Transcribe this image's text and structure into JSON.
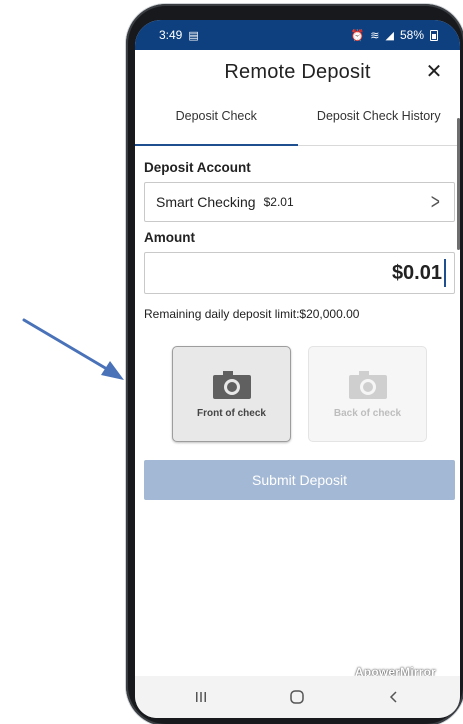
{
  "status_bar": {
    "time": "3:49",
    "battery": "58%"
  },
  "header": {
    "title": "Remote Deposit",
    "close_glyph": "✕"
  },
  "tabs": [
    {
      "label": "Deposit Check",
      "active": true
    },
    {
      "label": "Deposit Check History",
      "active": false
    }
  ],
  "deposit_account": {
    "label": "Deposit Account",
    "account_name": "Smart Checking",
    "balance": "$2.01"
  },
  "amount": {
    "label": "Amount",
    "value": "$0.01"
  },
  "limit_text": "Remaining daily deposit limit:$20,000.00",
  "capture": {
    "front_label": "Front of check",
    "back_label": "Back of check"
  },
  "submit": {
    "label": "Submit Deposit"
  },
  "watermark": "ApowerMirror",
  "colors": {
    "status_bar": "#0e3f7e",
    "active_tab_underline": "#1f4f8f",
    "submit_disabled": "#a3b8d4",
    "annotation_arrow": "#4a72b8"
  },
  "icons": {
    "close": "close-icon",
    "chevron": "chevron-right-icon",
    "camera": "camera-icon",
    "nav_recents": "recents-icon",
    "nav_home": "home-icon",
    "nav_back": "back-icon"
  }
}
